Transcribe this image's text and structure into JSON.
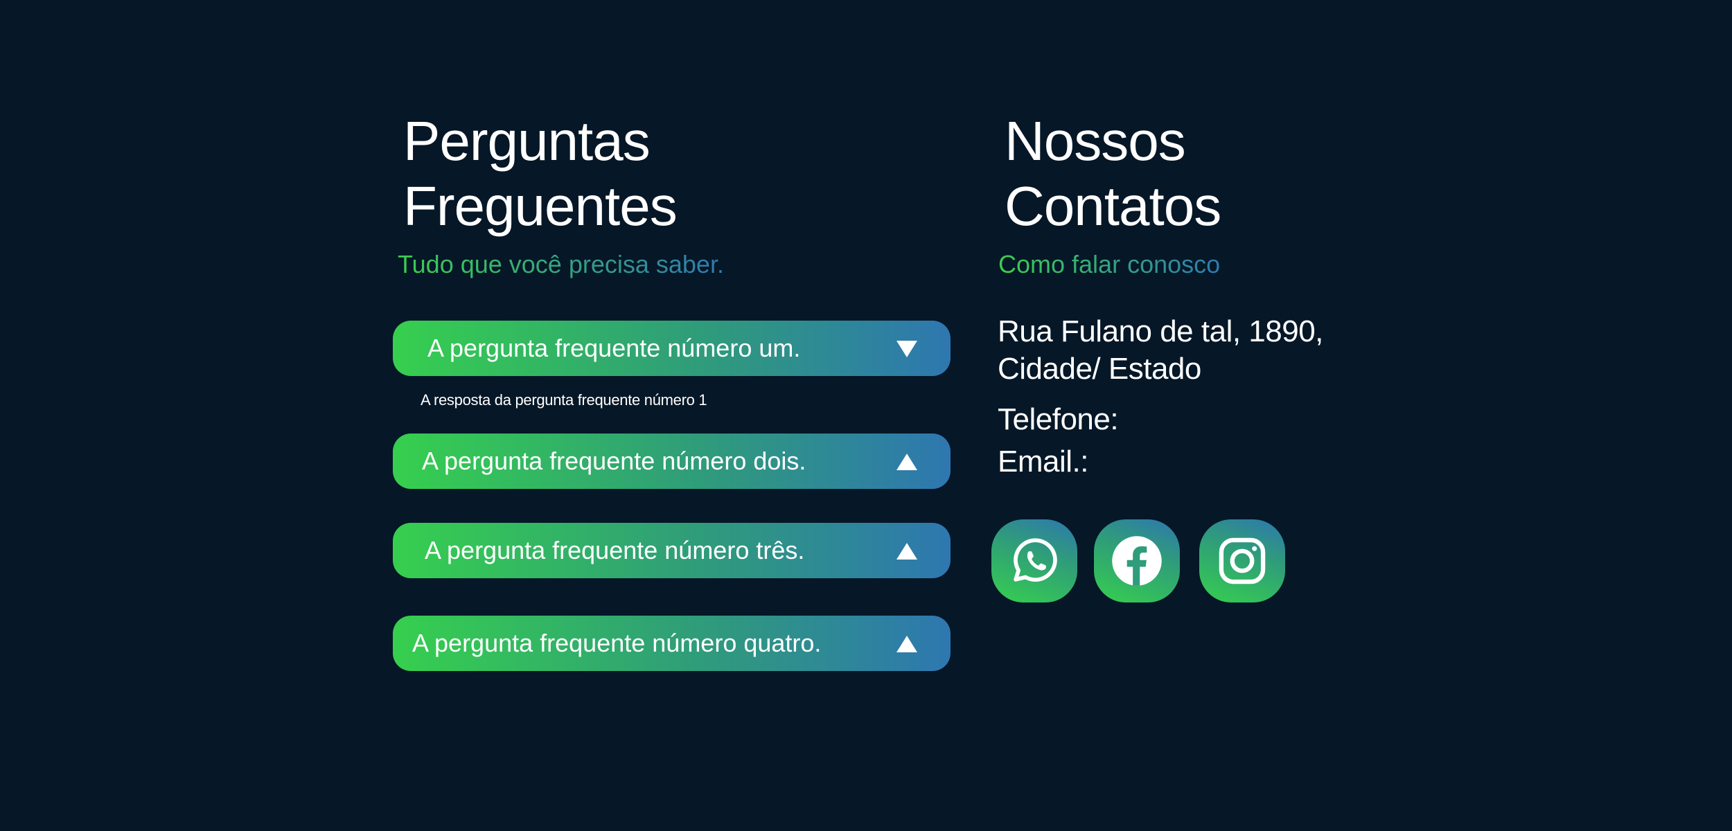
{
  "faq": {
    "title_line1": "Perguntas",
    "title_line2": "Freguentes",
    "subtitle": "Tudo que você precisa saber.",
    "items": [
      {
        "question": "A pergunta frequente número um.",
        "answer": "A resposta da pergunta frequente número 1",
        "expanded": true
      },
      {
        "question": "A pergunta frequente número dois.",
        "expanded": false
      },
      {
        "question": "A pergunta frequente número três.",
        "expanded": false
      },
      {
        "question": "A pergunta frequente número quatro.",
        "expanded": false
      }
    ]
  },
  "contact": {
    "title_line1": "Nossos",
    "title_line2": "Contatos",
    "subtitle": "Como falar conosco",
    "address_line1": "Rua Fulano de tal, 1890,",
    "address_line2": "Cidade/ Estado",
    "phone_label": "Telefone:",
    "email_label": "Email.:",
    "social": [
      {
        "name": "whatsapp",
        "icon": "whatsapp-icon"
      },
      {
        "name": "facebook",
        "icon": "facebook-icon"
      },
      {
        "name": "instagram",
        "icon": "instagram-icon"
      }
    ]
  },
  "colors": {
    "background": "#061727",
    "gradient_start": "#36cf4e",
    "gradient_end": "#2e77b0",
    "text": "#ffffff"
  }
}
